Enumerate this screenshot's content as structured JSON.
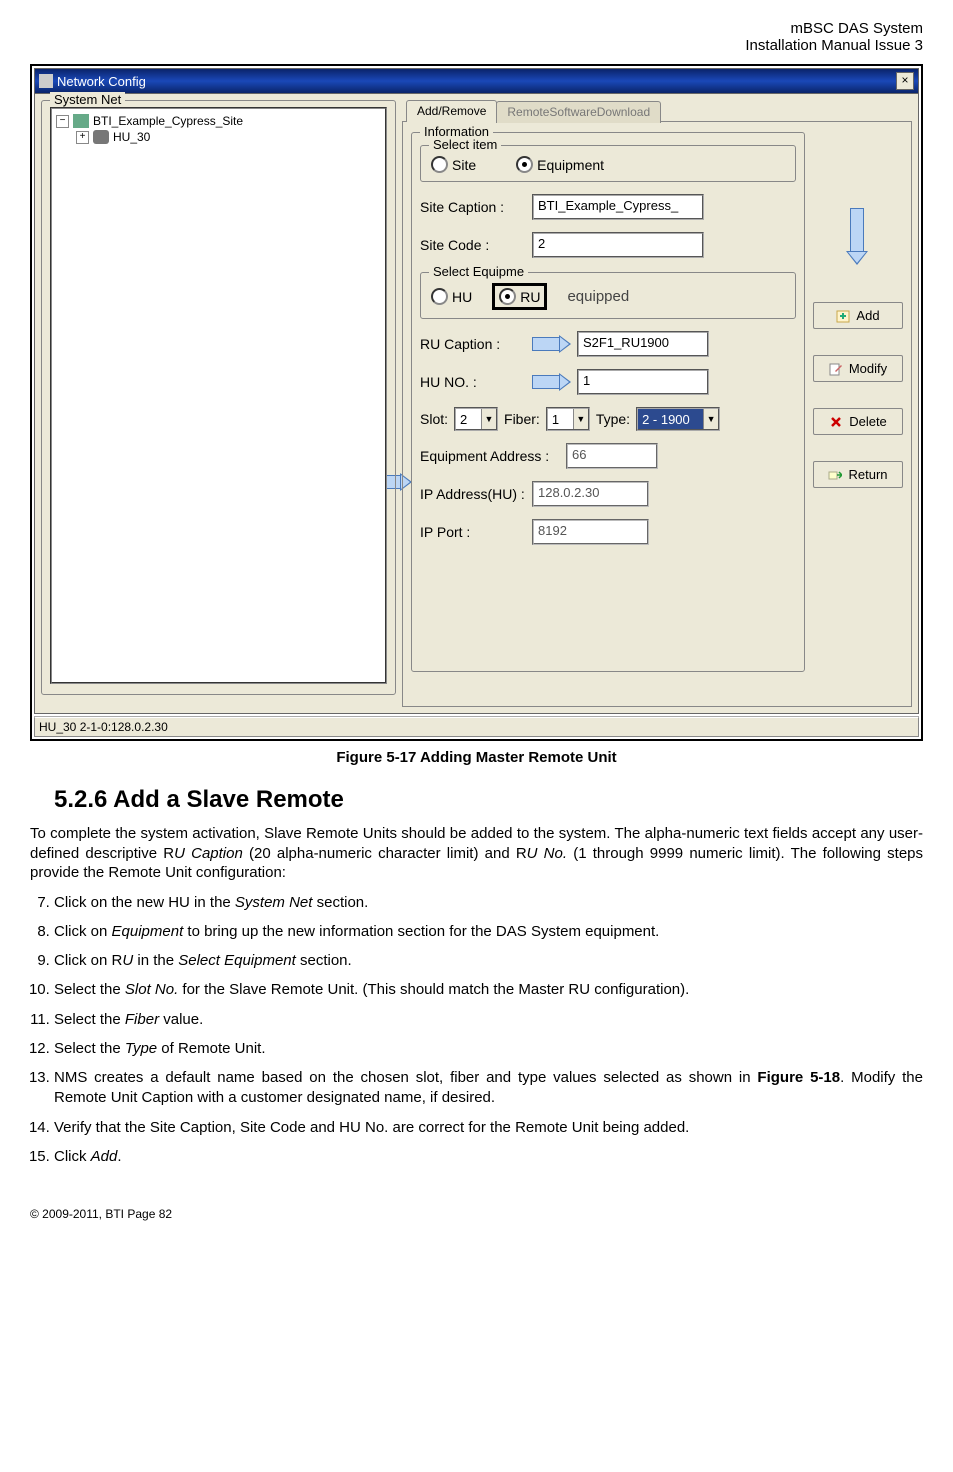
{
  "header": {
    "line1": "mBSC DAS System",
    "line2": "Installation Manual Issue 3"
  },
  "window": {
    "title": "Network Config",
    "close_glyph": "×",
    "sysnet_legend": "System Net",
    "tree": {
      "site_expander": "−",
      "site_label": "BTI_Example_Cypress_Site",
      "hu_expander": "+",
      "hu_label": "HU_30"
    },
    "tabs": {
      "tab1": "Add/Remove",
      "tab2": "RemoteSoftwareDownload"
    },
    "info_legend": "Information",
    "select_item": {
      "legend": "Select item",
      "site": "Site",
      "equipment": "Equipment"
    },
    "fields": {
      "site_caption_label": "Site Caption :",
      "site_caption_value": "BTI_Example_Cypress_",
      "site_code_label": "Site Code :",
      "site_code_value": "2"
    },
    "select_equip": {
      "legend": "Select Equipme",
      "hu": "HU",
      "ru": "RU",
      "equipped": "equipped"
    },
    "fields2": {
      "ru_caption_label": "RU Caption :",
      "ru_caption_value": "S2F1_RU1900",
      "hu_no_label": "HU NO. :",
      "hu_no_value": "1",
      "slot_label": "Slot:",
      "slot_value": "2",
      "fiber_label": "Fiber:",
      "fiber_value": "1",
      "type_label": "Type:",
      "type_value": "2 - 1900",
      "equip_addr_label": "Equipment Address :",
      "equip_addr_value": "66",
      "ip_addr_label": "IP Address(HU) :",
      "ip_addr_value": "128.0.2.30",
      "ip_port_label": "IP Port :",
      "ip_port_value": "8192"
    },
    "buttons": {
      "add": "Add",
      "modify": "Modify",
      "delete": "Delete",
      "return": "Return"
    },
    "status": "HU_30 2-1-0:128.0.2.30"
  },
  "caption": "Figure 5-17 Adding Master Remote Unit",
  "section_heading": "5.2.6  Add a Slave Remote",
  "para1_a": "To complete the system activation, Slave Remote Units should be added to the system. The alpha-numeric text fields accept any user-defined descriptive R",
  "para1_b": "U Caption",
  "para1_c": " (20 alpha-numeric character limit) and R",
  "para1_d": "U No.",
  "para1_e": " (1 through 9999 numeric limit). The following steps provide the Remote Unit configuration:",
  "steps": {
    "s7_a": "Click on the new HU in the ",
    "s7_b": "System Net",
    "s7_c": " section.",
    "s8_a": "Click on ",
    "s8_b": "Equipment",
    "s8_c": " to bring up the new information section for the DAS System equipment.",
    "s9_a": "Click on R",
    "s9_b": "U",
    "s9_c": " in the ",
    "s9_d": "Select Equipment",
    "s9_e": " section.",
    "s10_a": "Select the ",
    "s10_b": "Slot No.",
    "s10_c": " for the Slave Remote Unit. (This should match the Master RU configuration).",
    "s11_a": "Select the ",
    "s11_b": "Fiber",
    "s11_c": " value.",
    "s12_a": "Select the ",
    "s12_b": "Type",
    "s12_c": " of Remote Unit.",
    "s13_a": "NMS creates a default name based on the chosen slot, fiber and type values selected as shown in ",
    "s13_b": "Figure 5-18",
    "s13_c": ". Modify the Remote Unit Caption with a customer designated name, if desired.",
    "s14": "Verify that the Site Caption, Site Code and HU No. are correct for the Remote Unit being added.",
    "s15_a": "Click ",
    "s15_b": "Add",
    "s15_c": "."
  },
  "footer": "© 2009-2011, BTI Page 82"
}
